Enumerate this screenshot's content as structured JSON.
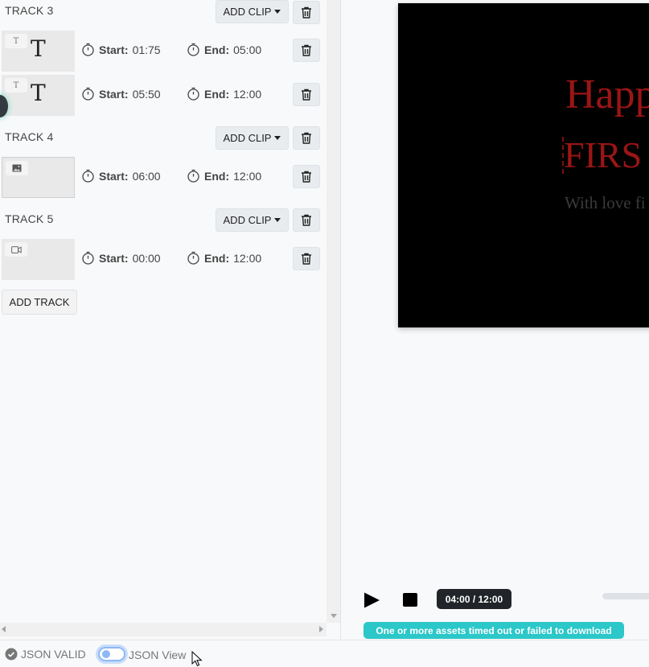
{
  "tracks": [
    {
      "title": "TRACK 3",
      "add_clip_label": "ADD CLIP",
      "clips": [
        {
          "badge": "T",
          "thumb_letter": "T",
          "start_label": "Start:",
          "start": "01:75",
          "end_label": "End:",
          "end": "05:00",
          "type": "text"
        },
        {
          "badge": "T",
          "thumb_letter": "T",
          "start_label": "Start:",
          "start": "05:50",
          "end_label": "End:",
          "end": "12:00",
          "type": "text"
        }
      ]
    },
    {
      "title": "TRACK 4",
      "add_clip_label": "ADD CLIP",
      "clips": [
        {
          "start_label": "Start:",
          "start": "06:00",
          "end_label": "End:",
          "end": "12:00",
          "type": "image"
        }
      ]
    },
    {
      "title": "TRACK 5",
      "add_clip_label": "ADD CLIP",
      "clips": [
        {
          "start_label": "Start:",
          "start": "00:00",
          "end_label": "End:",
          "end": "12:00",
          "type": "video"
        }
      ]
    }
  ],
  "add_track_label": "ADD TRACK",
  "preview": {
    "line1": "Happ",
    "line2": "FIRS",
    "line3": "With love fi",
    "text_color": "#9b1515",
    "background": "#000000"
  },
  "player": {
    "time_display": "04:00 / 12:00",
    "warning": "One or more assets timed out or failed to download",
    "warning_color": "#2bc7c9"
  },
  "status_bar": {
    "json_valid_label": "JSON VALID",
    "json_view_label": "JSON View"
  },
  "icons": {
    "delete": "trash-icon",
    "timer": "stopwatch-icon",
    "image": "image-icon",
    "video": "video-camera-icon",
    "check": "check-circle-icon"
  }
}
